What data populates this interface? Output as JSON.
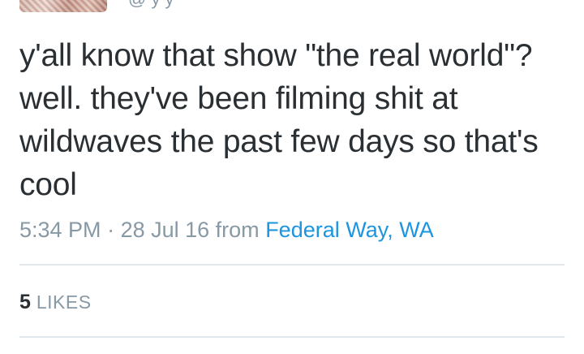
{
  "tweet": {
    "handle_fragment": "@ y y",
    "text": "y'all know that show \"the real world\"? well. they've been filming shit at wildwaves the past few days so that's cool",
    "time": "5:34 PM",
    "separator": " · ",
    "date": "28 Jul 16",
    "from_label": "from",
    "location": "Federal Way, WA"
  },
  "stats": {
    "likes_count": "5",
    "likes_label": "LIKES"
  },
  "colors": {
    "text": "#292f33",
    "muted": "#8899a6",
    "link": "#1b95e0",
    "divider": "#e1e8ed"
  },
  "icons": {
    "avatar": "user-avatar-image"
  }
}
